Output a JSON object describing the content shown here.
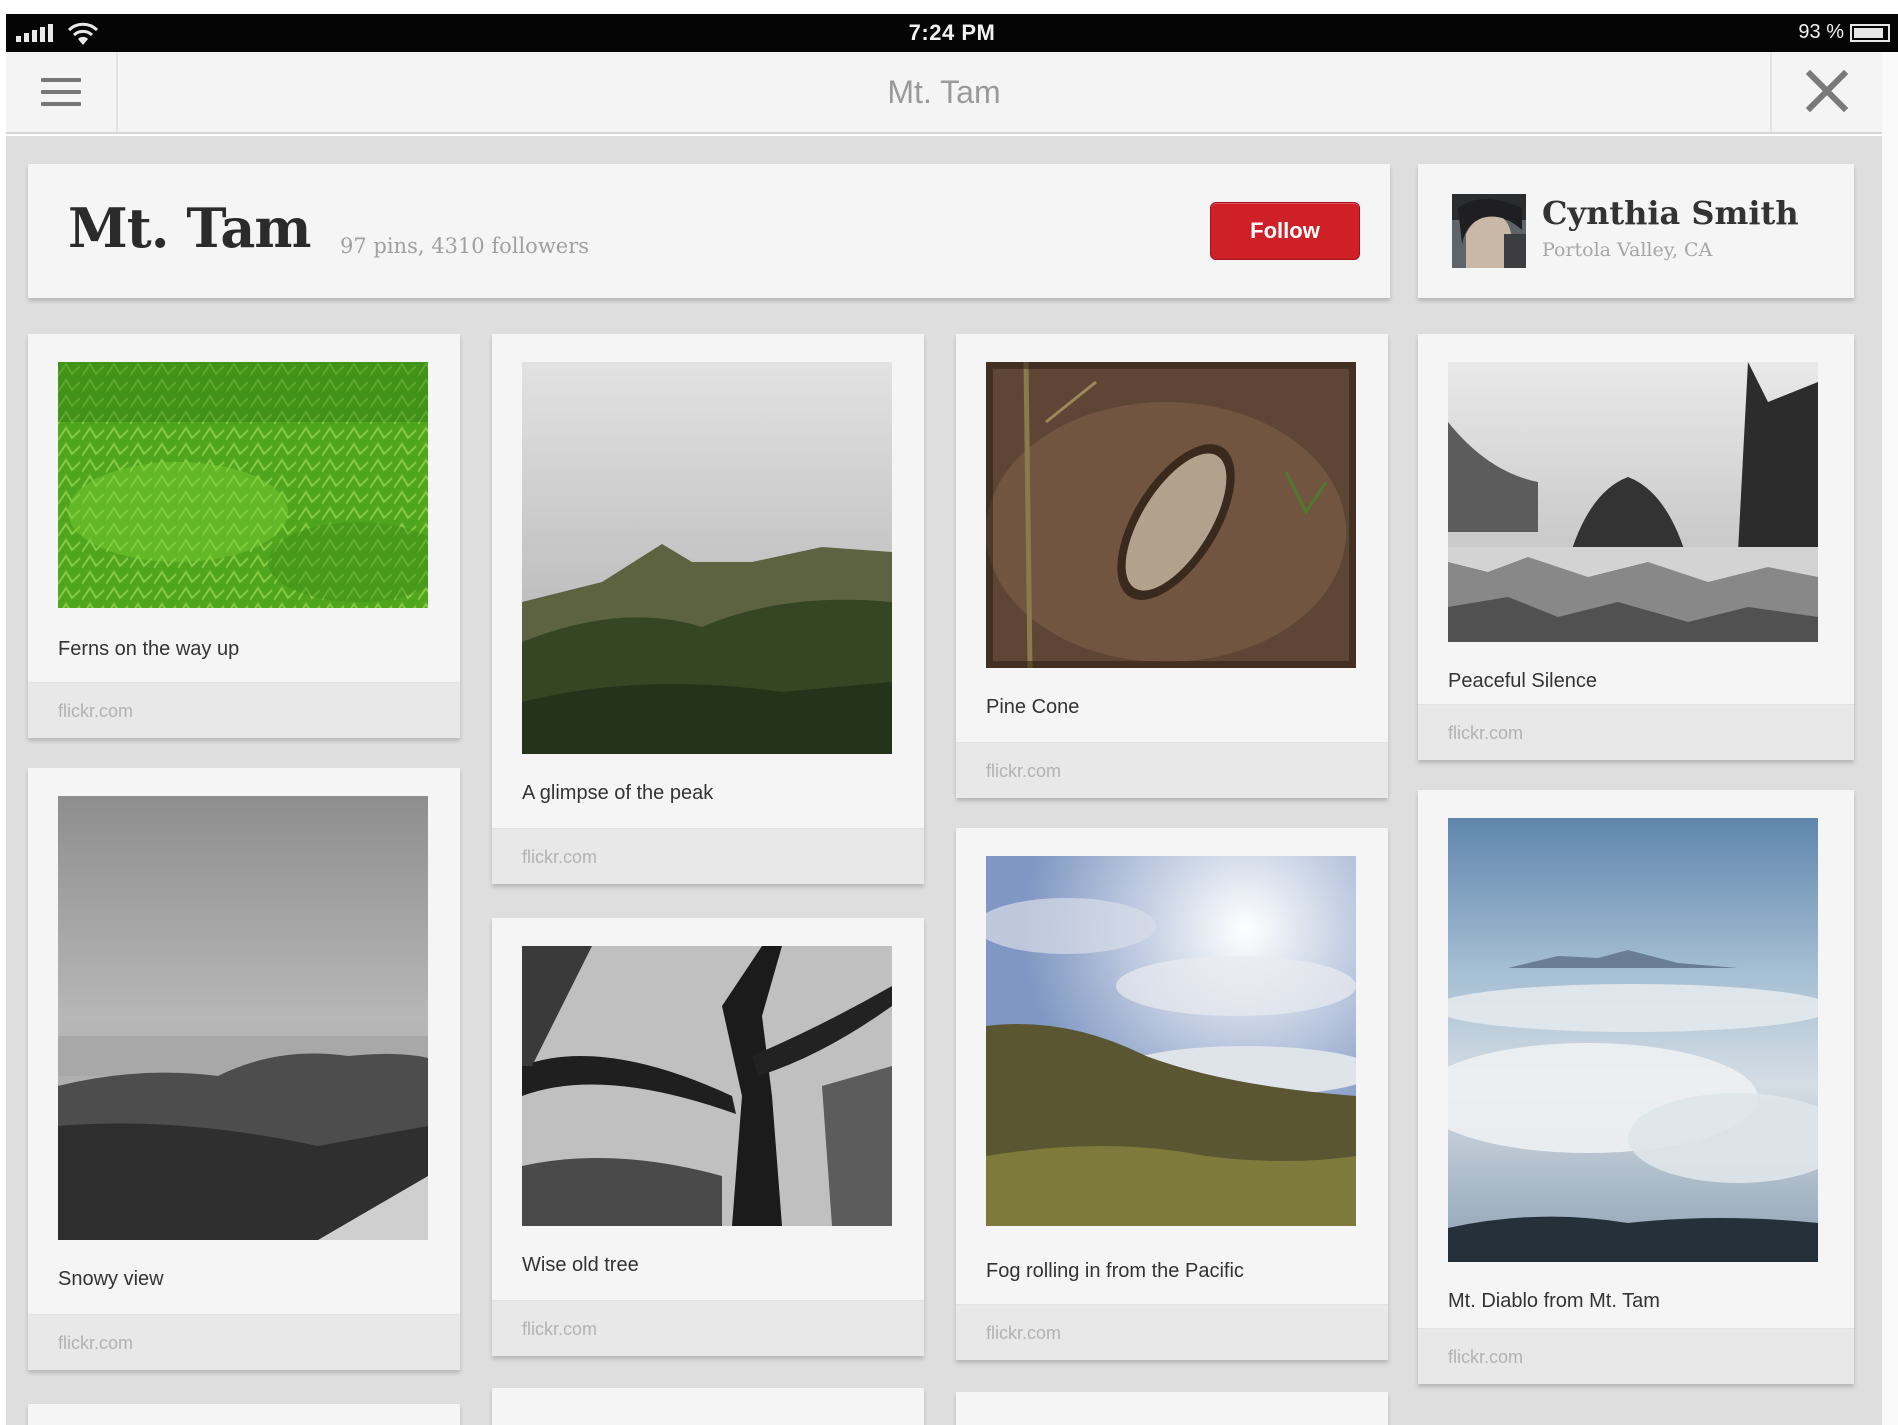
{
  "status_bar": {
    "time": "7:24 PM",
    "battery": "93 %"
  },
  "nav": {
    "title": "Mt. Tam",
    "menu_icon": "hamburger-icon",
    "close_icon": "close-icon"
  },
  "board": {
    "title": "Mt. Tam",
    "stats": "97 pins, 4310 followers",
    "follow_label": "Follow",
    "follow_color": "#cf1f27"
  },
  "user": {
    "name": "Cynthia Smith",
    "location": "Portola Valley, CA"
  },
  "pins": [
    {
      "caption": "Ferns on the way up",
      "source": "flickr.com",
      "image": "ferns-photo"
    },
    {
      "caption": "Snowy view",
      "source": "flickr.com",
      "image": "snowy-view-photo"
    },
    {
      "caption": "A glimpse of the peak",
      "source": "flickr.com",
      "image": "peak-photo"
    },
    {
      "caption": "Wise old tree",
      "source": "flickr.com",
      "image": "tree-photo"
    },
    {
      "caption": "Pine Cone",
      "source": "flickr.com",
      "image": "pine-cone-photo"
    },
    {
      "caption": "Fog rolling in from the Pacific",
      "source": "flickr.com",
      "image": "fog-photo"
    },
    {
      "caption": "Peaceful Silence",
      "source": "flickr.com",
      "image": "silence-photo"
    },
    {
      "caption": "Mt. Diablo from Mt. Tam",
      "source": "flickr.com",
      "image": "diablo-photo"
    }
  ]
}
